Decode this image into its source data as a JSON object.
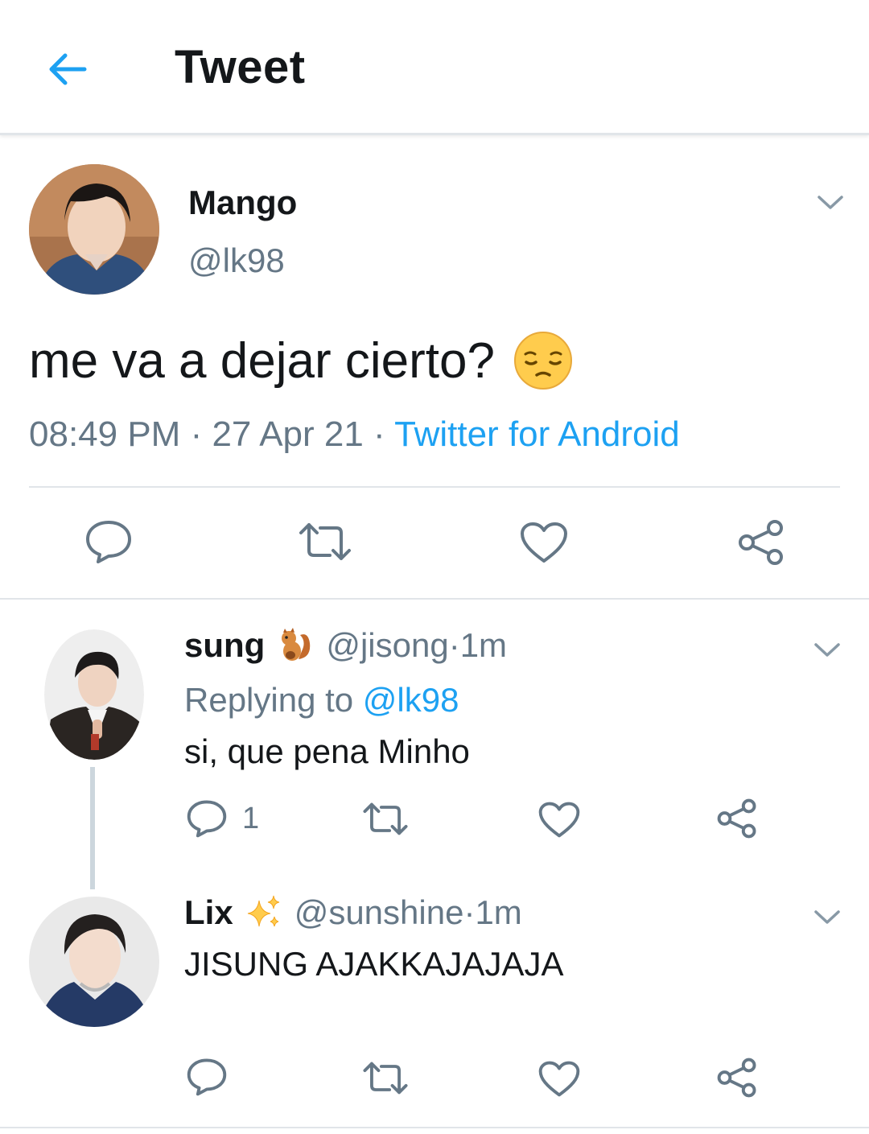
{
  "header": {
    "title": "Tweet"
  },
  "main_tweet": {
    "display_name": "Mango",
    "handle": "@lk98",
    "text": "me va a dejar cierto?",
    "emoji": "pensive-face",
    "time": "08:49 PM",
    "date": "27 Apr 21",
    "source": "Twitter for Android",
    "separator": " · "
  },
  "replies": [
    {
      "display_name": "sung",
      "name_emoji": "squirrel",
      "handle": "@jisong",
      "age": "1m",
      "replying_prefix": "Replying to",
      "replying_to": "@lk98",
      "text": "si, que pena Minho",
      "reply_count": "1"
    },
    {
      "display_name": "Lix",
      "name_emoji": "sparkles",
      "handle": "@sunshine",
      "age": "1m",
      "text": "JISUNG AJAKKAJAJAJA"
    }
  ],
  "colors": {
    "accent": "#1da1f2",
    "secondary_text": "#657786",
    "primary_text": "#14171a",
    "divider": "#e1e5e9"
  }
}
